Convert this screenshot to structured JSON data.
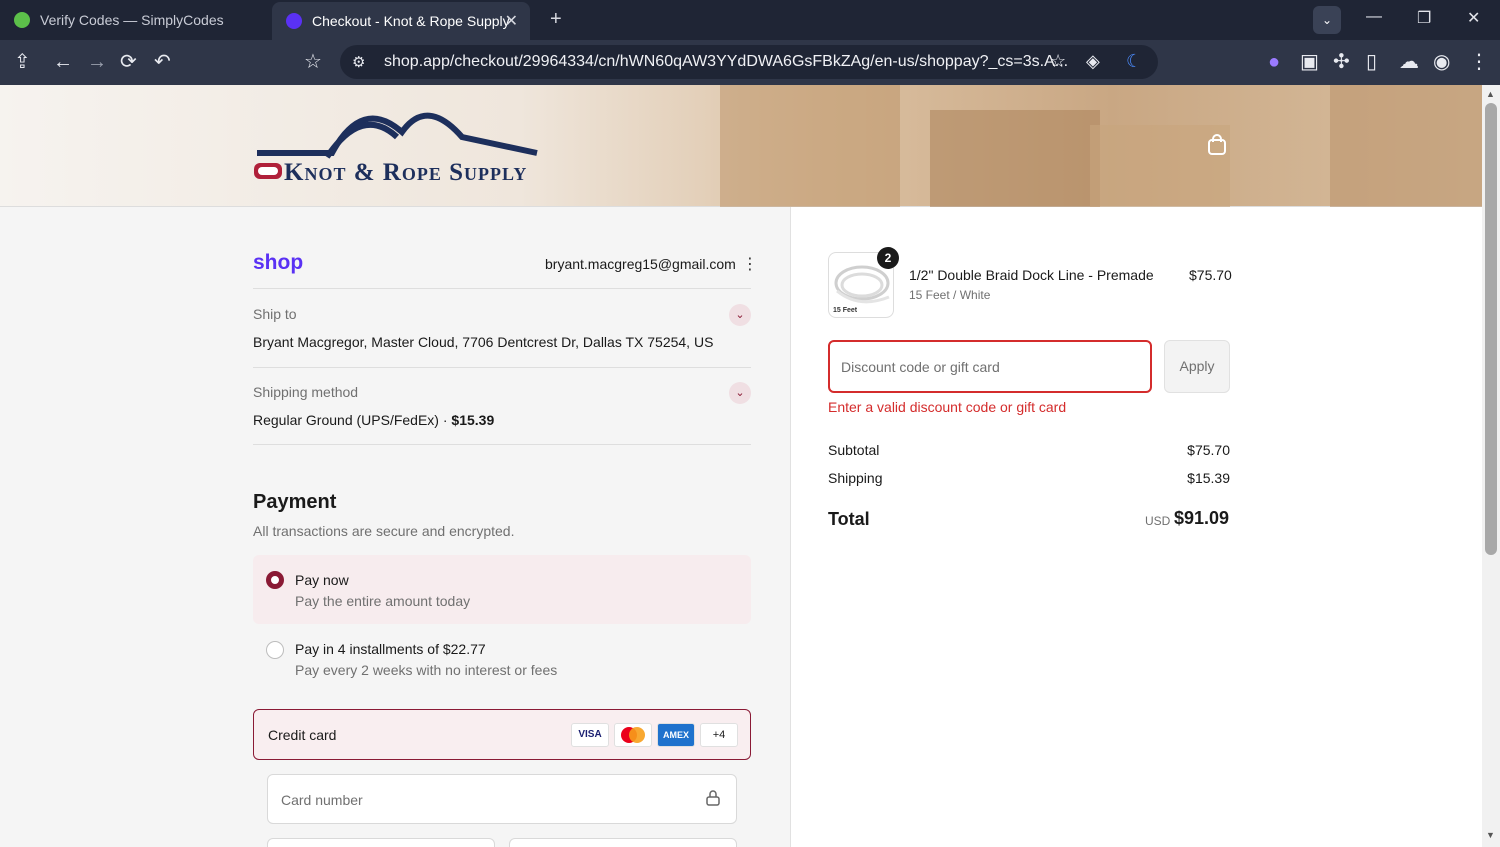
{
  "browser": {
    "tabs": [
      {
        "title": "Verify Codes — SimplyCodes",
        "active": false
      },
      {
        "title": "Checkout - Knot & Rope Supply",
        "active": true
      }
    ],
    "url": "shop.app/checkout/29964334/cn/hWN60qAW3YYdDWA6GsFBkZAg/en-us/shoppay?_cs=3s.A..."
  },
  "header": {
    "brand": "Knot & Rope Supply"
  },
  "account": {
    "shop_label": "shop",
    "email": "bryant.macgreg15@gmail.com"
  },
  "shipping": {
    "ship_to_label": "Ship to",
    "ship_to_value": "Bryant Macgregor, Master Cloud, 7706 Dentcrest Dr, Dallas TX 75254, US",
    "method_label": "Shipping method",
    "method_value": "Regular Ground (UPS/FedEx) · ",
    "method_price": "$15.39"
  },
  "payment": {
    "title": "Payment",
    "subtitle": "All transactions are secure and encrypted.",
    "options": [
      {
        "title": "Pay now",
        "sub": "Pay the entire amount today",
        "selected": true
      },
      {
        "title": "Pay in 4 installments of $22.77",
        "sub": "Pay every 2 weeks with no interest or fees",
        "selected": false
      }
    ],
    "credit_card_label": "Credit card",
    "card_logos": [
      "VISA",
      "MC",
      "AMEX",
      "+4"
    ],
    "card_number_placeholder": "Card number"
  },
  "order": {
    "item": {
      "quantity": "2",
      "name": "1/2\" Double Braid Dock Line - Premade",
      "variant": "15 Feet / White",
      "price": "$75.70",
      "thumb_label": "15 Feet"
    },
    "discount_placeholder": "Discount code or gift card",
    "apply_label": "Apply",
    "discount_error": "Enter a valid discount code or gift card",
    "subtotal_label": "Subtotal",
    "subtotal_value": "$75.70",
    "shipping_label": "Shipping",
    "shipping_value": "$15.39",
    "total_label": "Total",
    "total_currency": "USD",
    "total_value": "$91.09"
  },
  "colors": {
    "accent": "#8a1a35",
    "error": "#d42c2c",
    "shop_purple": "#5a31f4",
    "chrome_dark": "#1f2535"
  }
}
